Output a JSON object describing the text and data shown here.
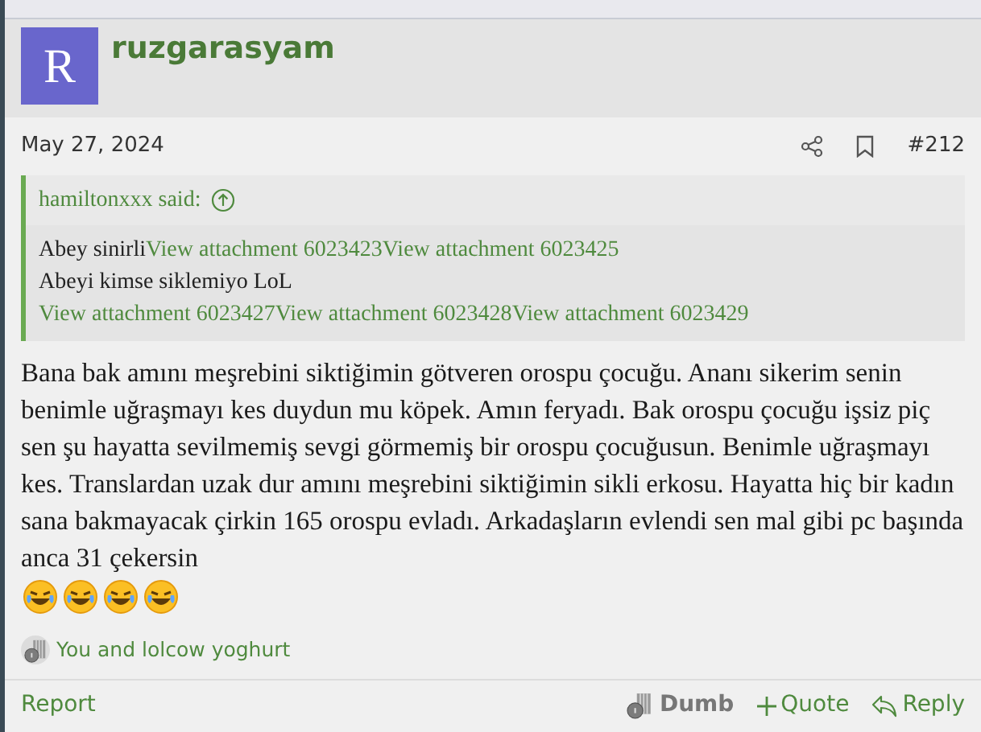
{
  "post": {
    "avatar_letter": "R",
    "username": "ruzgarasyam",
    "date": "May 27, 2024",
    "number": "#212"
  },
  "quote": {
    "author": "hamiltonxxx said:",
    "lines": [
      [
        {
          "kind": "text",
          "text": "Abey sinirli"
        },
        {
          "kind": "link",
          "text": "View attachment 6023423"
        },
        {
          "kind": "link",
          "text": "View attachment 6023425"
        }
      ],
      [
        {
          "kind": "text",
          "text": "Abeyi kimse siklemiyo LoL"
        }
      ],
      [
        {
          "kind": "link",
          "text": "View attachment 6023427"
        },
        {
          "kind": "link",
          "text": "View attachment 6023428"
        },
        {
          "kind": "link",
          "text": "View attachment 6023429"
        }
      ]
    ]
  },
  "body": {
    "text": "Bana bak amını meşrebini siktiğimin götveren orospu çocuğu. Ananı sikerim senin benimle uğraşmayı kes duydun mu köpek. Amın feryadı. Bak orospu çocuğu işsiz piç sen şu hayatta sevilmemiş sevgi görmemiş bir orospu çocuğusun. Benimle uğraşmayı kes. Translardan uzak dur amını meşrebini siktiğimin sikli erkosu. Hayatta hiç bir kadın sana bakmayacak çirkin 165 orospu evladı. Arkadaşların evlendi sen mal gibi pc başında anca 31 çekersin",
    "smilies": [
      {
        "kind": "laugh"
      },
      {
        "kind": "laugh"
      },
      {
        "kind": "laugh"
      },
      {
        "kind": "laugh"
      }
    ]
  },
  "reactions": {
    "text": "You and lolcow yoghurt"
  },
  "footer": {
    "report": "Report",
    "actions": [
      {
        "kind": "dumb",
        "label": "Dumb"
      },
      {
        "kind": "quote",
        "label": "Quote"
      },
      {
        "kind": "reply",
        "label": "Reply"
      }
    ]
  }
}
